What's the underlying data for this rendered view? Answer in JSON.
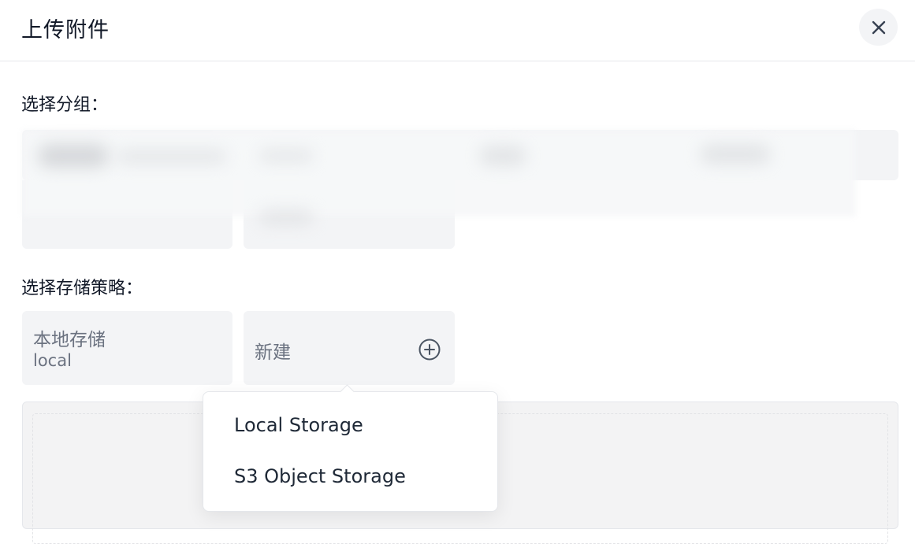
{
  "dialog": {
    "title": "上传附件",
    "close_icon": "close-icon"
  },
  "group_section": {
    "label": "选择分组："
  },
  "policy_section": {
    "label": "选择存储策略：",
    "policies": [
      {
        "name": "本地存储",
        "sub": "local"
      }
    ],
    "new_label": "新建",
    "new_icon": "plus-circle-icon"
  },
  "dropdown": {
    "items": [
      "Local Storage",
      "S3 Object Storage"
    ]
  }
}
